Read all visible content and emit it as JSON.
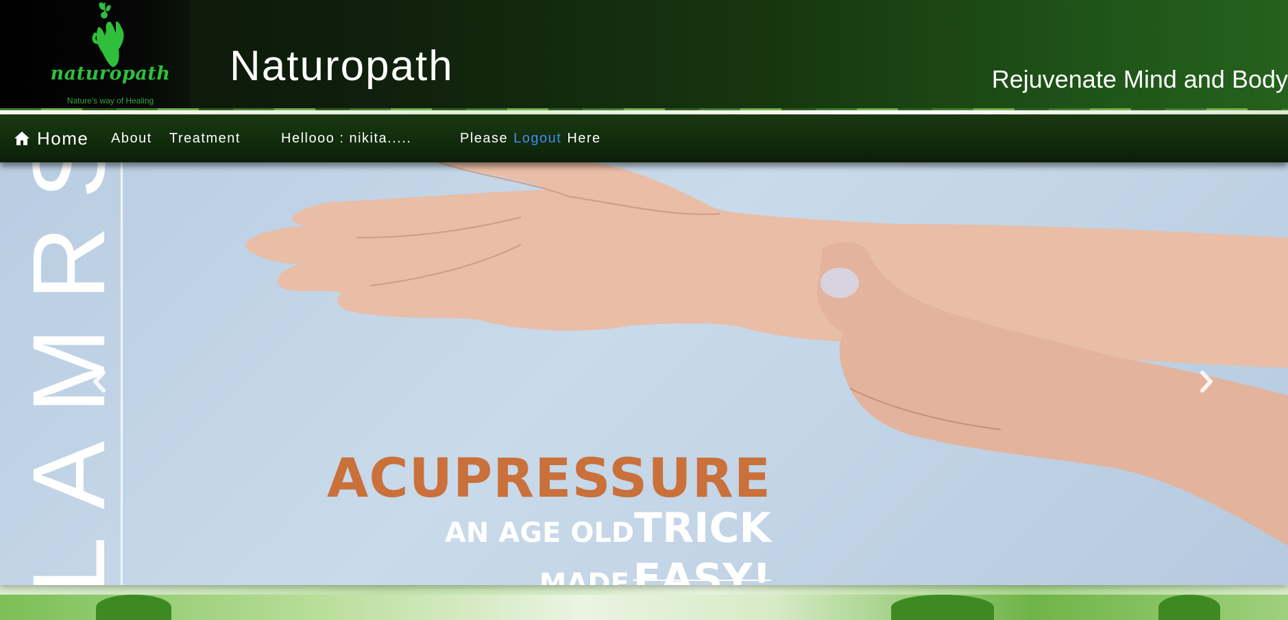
{
  "header": {
    "logo_text": "naturopath",
    "logo_tagline": "Nature's way of Healing",
    "site_title": "Naturopath",
    "tagline": "Rejuvenate Mind and Body"
  },
  "nav": {
    "home_label": "Home",
    "home_icon": "home-icon",
    "about_label": "About",
    "treatment_label": "Treatment",
    "greeting": "Hellooo : nikita.....",
    "logout_prefix": "Please",
    "logout_link": "Logout",
    "logout_suffix": "Here"
  },
  "carousel": {
    "side_text": "LAMRS",
    "title": "ACUPRESSURE",
    "line2_small": "AN AGE OLD",
    "line2_big": "TRICK",
    "line3_small": "MADE",
    "line3_big": "EASY!",
    "prev_icon": "chevron-left-icon",
    "next_icon": "chevron-right-icon"
  },
  "colors": {
    "header_dark": "#0b1408",
    "header_green": "#25621d",
    "logo_green": "#2fbf3c",
    "link_blue": "#3f8ff0",
    "caption_orange": "#c9703b"
  }
}
